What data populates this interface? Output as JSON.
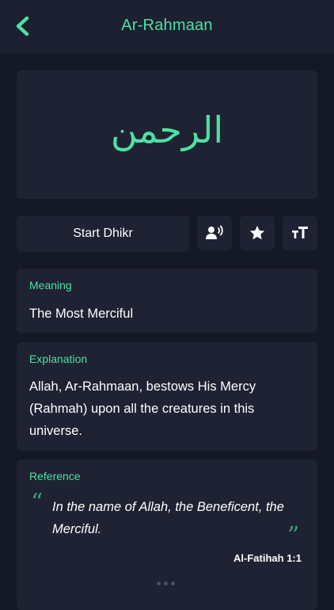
{
  "header": {
    "title": "Ar-Rahmaan"
  },
  "name": {
    "arabic": "الرحمن"
  },
  "actions": {
    "start_dhikr_label": "Start Dhikr",
    "icons": [
      "speak-icon",
      "star-icon",
      "text-size-icon"
    ]
  },
  "meaning": {
    "label": "Meaning",
    "text": "The Most Merciful"
  },
  "explanation": {
    "label": "Explanation",
    "text": "Allah, Ar-Rahmaan, bestows His Mercy (Rahmah) upon all the creatures in this universe."
  },
  "reference": {
    "label": "Reference",
    "quote": "In the name of Allah, the Beneficent, the Merciful.",
    "source": "Al-Fatihah  1:1"
  },
  "colors": {
    "accent": "#4ee0a2",
    "background": "#151827",
    "card": "#1e2232"
  }
}
